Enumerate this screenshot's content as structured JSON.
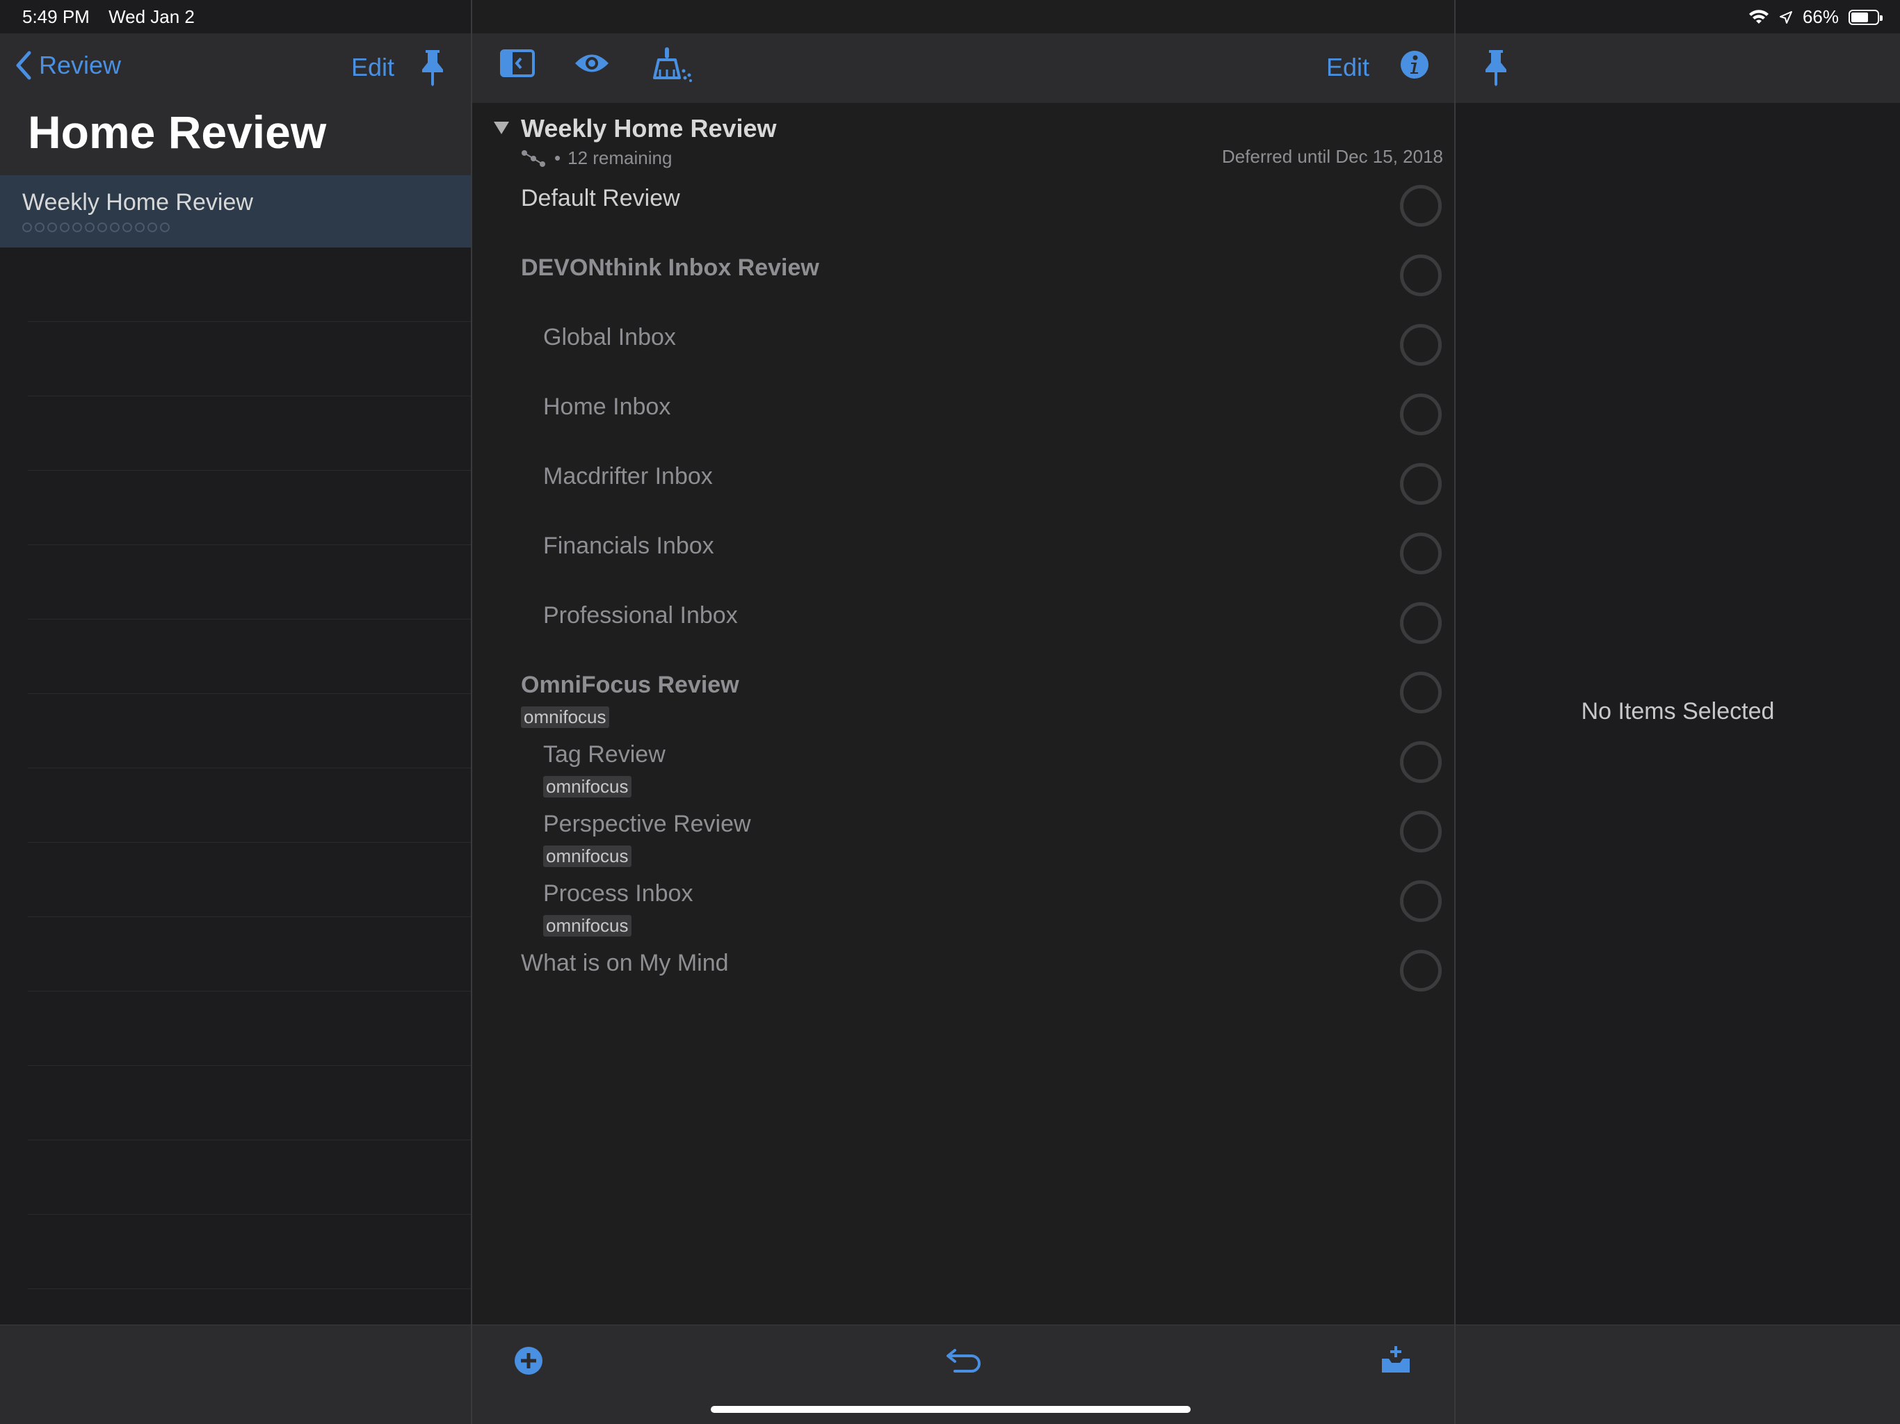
{
  "status_bar": {
    "time": "5:49 PM",
    "date": "Wed Jan 2",
    "battery_percent": "66%",
    "battery_level": 0.66
  },
  "left_pane": {
    "back_label": "Review",
    "edit_label": "Edit",
    "title": "Home Review",
    "selected_item": "Weekly Home Review"
  },
  "middle_pane": {
    "edit_label": "Edit",
    "group": {
      "title": "Weekly Home Review",
      "remaining": "12 remaining",
      "deferred": "Deferred until Dec 15, 2018"
    },
    "items": [
      {
        "label": "Default Review",
        "tag": ""
      },
      {
        "label": "DEVONthink Inbox Review",
        "tag": ""
      },
      {
        "label": "Global Inbox",
        "tag": ""
      },
      {
        "label": "Home Inbox",
        "tag": ""
      },
      {
        "label": "Macdrifter Inbox",
        "tag": ""
      },
      {
        "label": "Financials Inbox",
        "tag": ""
      },
      {
        "label": "Professional Inbox",
        "tag": ""
      },
      {
        "label": "OmniFocus Review",
        "tag": "omnifocus"
      },
      {
        "label": "Tag Review",
        "tag": "omnifocus"
      },
      {
        "label": "Perspective Review",
        "tag": "omnifocus"
      },
      {
        "label": "Process Inbox",
        "tag": "omnifocus"
      },
      {
        "label": "What is on My Mind",
        "tag": ""
      }
    ]
  },
  "right_pane": {
    "empty_message": "No Items Selected"
  },
  "colors": {
    "accent": "#4a90e2",
    "background": "#1c1c1e",
    "selection": "#2c3a4a"
  }
}
